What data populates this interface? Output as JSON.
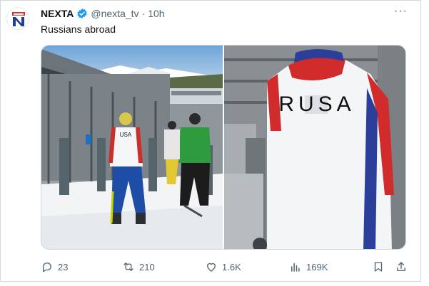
{
  "tweet": {
    "author_name": "NEXTA",
    "handle": "@nexta_tv",
    "separator": "·",
    "time": "10h",
    "text": "Russians abroad",
    "verified": true
  },
  "media": {
    "left_photo_jacket_text": "USA",
    "right_photo_jacket_text": "RUSA"
  },
  "actions": {
    "replies": "23",
    "reposts": "210",
    "likes": "1.6K",
    "views": "169K"
  },
  "colors": {
    "brand_red": "#d92b2b",
    "brand_navy": "#1f3f8f",
    "verified_blue": "#1d9bf0",
    "text_secondary": "#536471"
  }
}
